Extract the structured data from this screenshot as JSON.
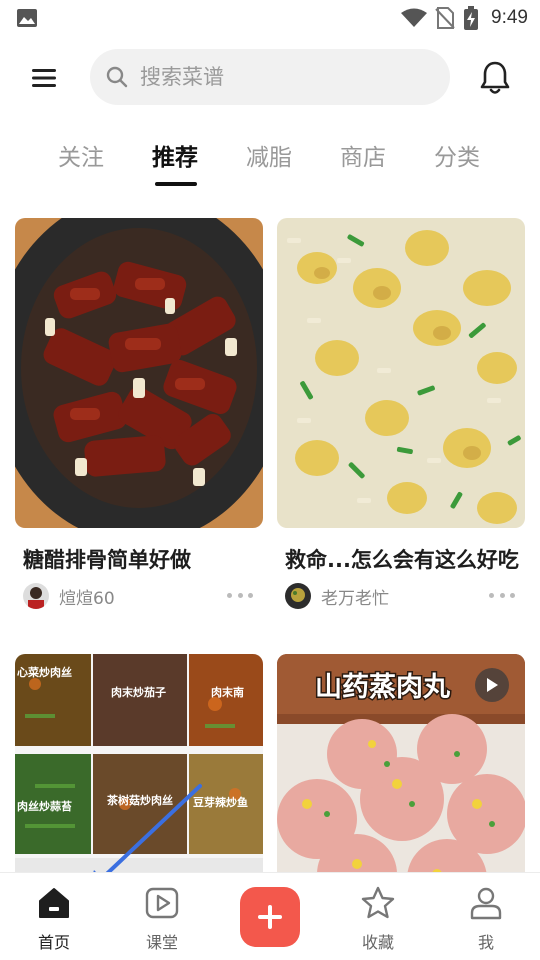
{
  "status_bar": {
    "time": "9:49"
  },
  "header": {
    "search_placeholder": "搜索菜谱"
  },
  "tabs": [
    {
      "label": "关注",
      "active": false
    },
    {
      "label": "推荐",
      "active": true
    },
    {
      "label": "减脂",
      "active": false
    },
    {
      "label": "商店",
      "active": false
    },
    {
      "label": "分类",
      "active": false
    }
  ],
  "feed": [
    {
      "title": "糖醋排骨简单好做",
      "author": "煊煊60"
    },
    {
      "title": "救命...怎么会有这么好吃",
      "author": "老万老忙"
    },
    {
      "title": "",
      "author": "",
      "cover_labels": [
        "心菜炒肉丝",
        "肉末炒茄子",
        "肉末南",
        "肉丝炒蒜苔",
        "茶树菇炒肉丝",
        "豆芽辣炒鱼"
      ]
    },
    {
      "title": "",
      "author": "",
      "cover_text": "山药蒸肉丸",
      "is_video": true
    }
  ],
  "bottom_nav": {
    "home": "首页",
    "class": "课堂",
    "favorites": "收藏",
    "me": "我"
  },
  "colors": {
    "accent": "#f3584c",
    "arrow": "#3b6fe0"
  }
}
